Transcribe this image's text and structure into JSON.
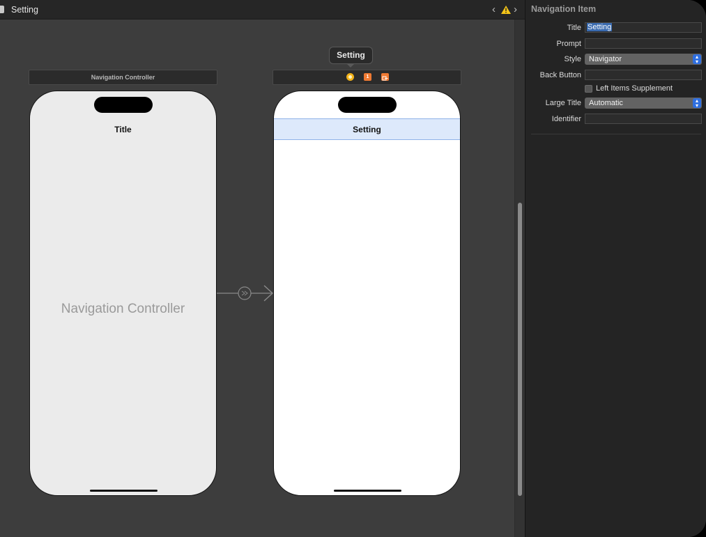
{
  "window": {
    "editor_title": "Setting"
  },
  "scenes": {
    "navigation_controller": {
      "dock_label": "Navigation Controller",
      "nav_title": "Title",
      "placeholder_label": "Navigation Controller"
    },
    "setting": {
      "tooltip": "Setting",
      "nav_title": "Setting",
      "dock_icons": [
        "view-controller-icon",
        "first-responder-icon",
        "exit-icon"
      ],
      "first_responder_glyph": "1"
    }
  },
  "inspector": {
    "section_title": "Navigation Item",
    "title_label": "Title",
    "title_value": "Setting",
    "prompt_label": "Prompt",
    "prompt_value": "",
    "style_label": "Style",
    "style_value": "Navigator",
    "back_button_label": "Back Button",
    "back_button_value": "",
    "left_items_label": "Left Items Supplement",
    "left_items_checked": false,
    "large_title_label": "Large Title",
    "large_title_value": "Automatic",
    "identifier_label": "Identifier",
    "identifier_value": ""
  },
  "colors": {
    "selection_bar": "#dde9fb",
    "warning": "#f5c518",
    "accent_blue": "#2f6fe0",
    "object_orange": "#ef7a33"
  }
}
